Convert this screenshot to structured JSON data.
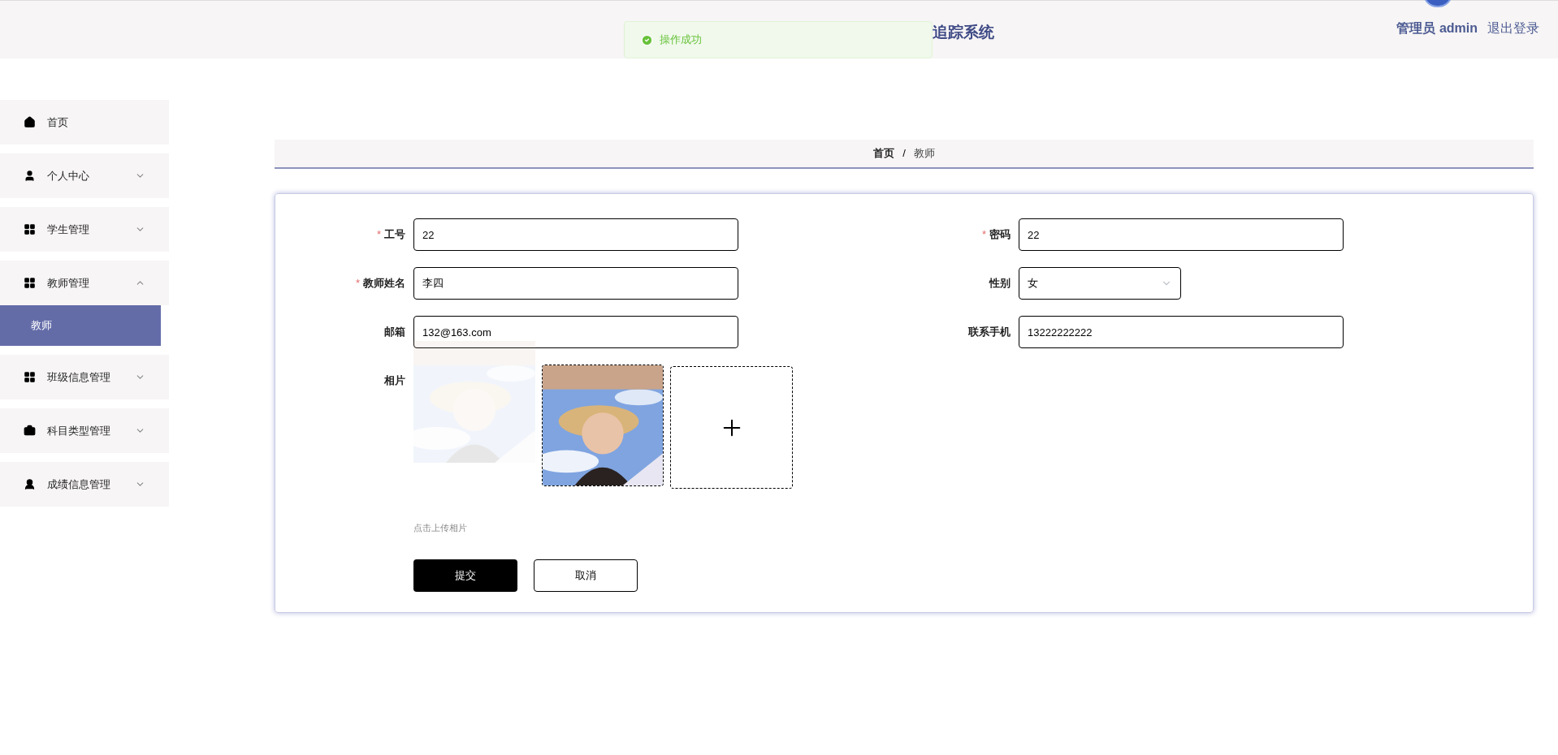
{
  "header": {
    "title": "追踪系统",
    "user": "管理员 admin",
    "logout": "退出登录"
  },
  "toast": {
    "message": "操作成功"
  },
  "sidebar": {
    "items": [
      {
        "label": "首页",
        "kind": "link"
      },
      {
        "label": "个人中心",
        "kind": "menu",
        "expanded": false
      },
      {
        "label": "学生管理",
        "kind": "menu",
        "expanded": false
      },
      {
        "label": "教师管理",
        "kind": "menu",
        "expanded": true,
        "children": [
          {
            "label": "教师",
            "selected": true
          }
        ]
      },
      {
        "label": "班级信息管理",
        "kind": "menu",
        "expanded": false
      },
      {
        "label": "科目类型管理",
        "kind": "menu",
        "expanded": false
      },
      {
        "label": "成绩信息管理",
        "kind": "menu",
        "expanded": false
      }
    ]
  },
  "breadcrumb": {
    "items": [
      "首页",
      "教师"
    ],
    "separator": "/"
  },
  "form": {
    "required_mark": "*",
    "left": [
      {
        "label": "工号",
        "required": true,
        "kind": "text",
        "value": "22"
      },
      {
        "label": "教师姓名",
        "required": true,
        "kind": "text",
        "value": "李四"
      },
      {
        "label": "邮箱",
        "required": false,
        "kind": "text",
        "value": "132@163.com"
      }
    ],
    "right": [
      {
        "label": "密码",
        "required": true,
        "kind": "text",
        "value": "22"
      },
      {
        "label": "性别",
        "required": false,
        "kind": "select",
        "value": "女"
      },
      {
        "label": "联系手机",
        "required": false,
        "kind": "text",
        "value": "13222222222"
      }
    ],
    "photo": {
      "label": "相片",
      "hint": "点击上传相片",
      "images": [
        {
          "kind": "picture",
          "ghost": true
        },
        {
          "kind": "picture",
          "ghost": false
        }
      ]
    },
    "buttons": [
      {
        "label": "提交",
        "kind": "primary"
      },
      {
        "label": "取消",
        "kind": "default"
      }
    ]
  }
}
